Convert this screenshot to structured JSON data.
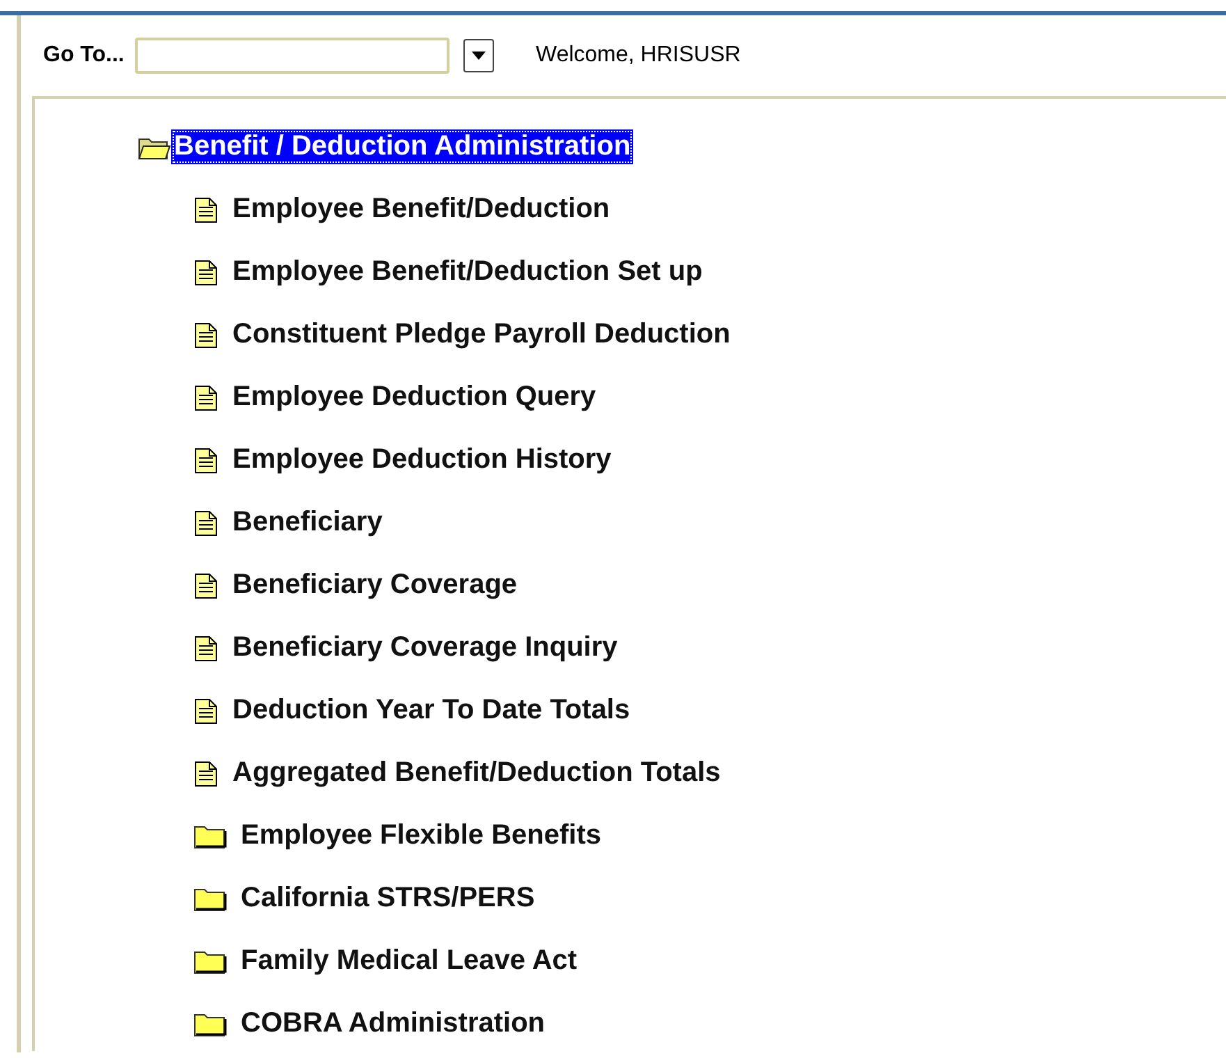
{
  "goto": {
    "label": "Go To..."
  },
  "welcome": "Welcome, HRISUSR",
  "tree": [
    {
      "label": "Benefit / Deduction Administration",
      "kind": "folder",
      "expanded": true,
      "selected": true,
      "children": [
        {
          "label": "Employee Benefit/Deduction",
          "kind": "form",
          "selected": false
        },
        {
          "label": "Employee Benefit/Deduction Set up",
          "kind": "form",
          "selected": false
        },
        {
          "label": "Constituent Pledge Payroll Deduction",
          "kind": "form",
          "selected": false
        },
        {
          "label": "Employee Deduction Query",
          "kind": "form",
          "selected": false
        },
        {
          "label": "Employee Deduction History",
          "kind": "form",
          "selected": false
        },
        {
          "label": "Beneficiary",
          "kind": "form",
          "selected": false
        },
        {
          "label": "Beneficiary Coverage",
          "kind": "form",
          "selected": false
        },
        {
          "label": "Beneficiary Coverage Inquiry",
          "kind": "form",
          "selected": false
        },
        {
          "label": "Deduction Year To Date Totals",
          "kind": "form",
          "selected": false
        },
        {
          "label": "Aggregated Benefit/Deduction Totals",
          "kind": "form",
          "selected": false
        },
        {
          "label": "Employee Flexible Benefits",
          "kind": "folder",
          "expanded": false,
          "selected": false
        },
        {
          "label": "California STRS/PERS",
          "kind": "folder",
          "expanded": false,
          "selected": false
        },
        {
          "label": "Family Medical Leave Act",
          "kind": "folder",
          "expanded": false,
          "selected": false
        },
        {
          "label": "COBRA Administration",
          "kind": "folder",
          "expanded": false,
          "selected": false
        }
      ]
    }
  ]
}
